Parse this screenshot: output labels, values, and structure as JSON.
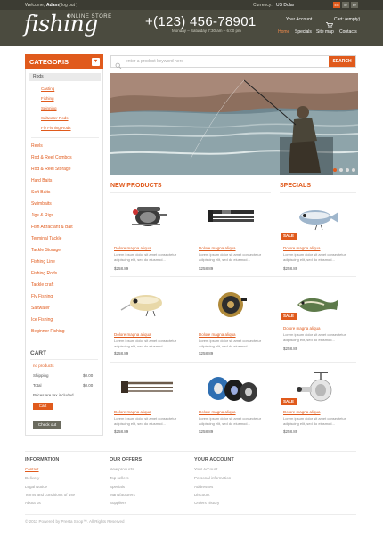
{
  "header": {
    "welcome": "Welcome,",
    "user": "Adam",
    "logout": "( log out )",
    "currency_label": "Currency:",
    "currency_value": "US Dolar",
    "lang1": "En",
    "lang2": "Ie",
    "lang3": "Fr",
    "logo": "fishing",
    "logo_sub": "ONLINE STORE",
    "phone": "+(123) 456-78901",
    "hours": "Monday – Saturday  7:30 am – 6:00 pm",
    "account": "Your Account",
    "cart": "Cart: (empty)",
    "nav": [
      "Home",
      "Specials",
      "Site map",
      "Contacts"
    ]
  },
  "sidebar": {
    "title": "CATEGORIS",
    "selected": "Rods",
    "subitems": [
      "Casting",
      "Fishing",
      "Spinning",
      "Saltwater Rods",
      "Fly Fishing Rods"
    ],
    "items": [
      "Reels",
      "Rod & Reel Combos",
      "Rod & Reel Storage",
      "Hard Baits",
      "Soft Baits",
      "Swimbaits",
      "Jigs & Rigs",
      "Fish Attractant & Bait",
      "Terminal Tackle",
      "Tackle Storage",
      "Fishing Line",
      "Fishing Rods",
      "Tackle craft",
      "Fly Fishing",
      "Saltwater",
      "Ice Fishing",
      "Beginner Fishing"
    ]
  },
  "cart": {
    "title": "CART",
    "no_products": "no products",
    "shipping_label": "Shipping",
    "shipping_value": "$0.00",
    "total_label": "Total",
    "total_value": "$0.00",
    "tax_note": "Prices are tax included",
    "cart_button": "Cart",
    "checkout_button": "Check out"
  },
  "search": {
    "placeholder": "enter a product keyword here",
    "button": "SEARCH"
  },
  "sections": {
    "new_products": "NEW PRODUCTS",
    "specials": "SPECIALS"
  },
  "product": {
    "title": "Dolore magna aliqua",
    "desc": "Lorem ipsum dolor sit amet consectetur adipiscing elit, sed do eiusmod...",
    "price": "$258.89",
    "sale": "SALE"
  },
  "footer": {
    "info_title": "INFORMATION",
    "info_links": [
      "Contact",
      "Delivery",
      "Legal Notice",
      "Terms and conditions of use",
      "About us"
    ],
    "offers_title": "OUR OFFERS",
    "offers_links": [
      "New products",
      "Top sellers",
      "Specials",
      "Manufacturers",
      "Suppliers"
    ],
    "account_title": "YOUR ACCOUNT",
    "account_links": [
      "Your Account",
      "Personal information",
      "Addresses",
      "Discount",
      "Orders history"
    ],
    "copyright": "© 2011 Powered by Presta Shop™. All Rights Reserved"
  },
  "colors": {
    "accent": "#e05a1c",
    "header": "#4b4b3f"
  }
}
